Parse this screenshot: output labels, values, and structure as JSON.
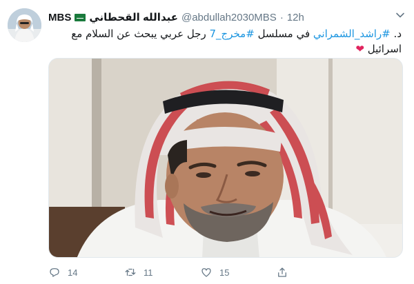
{
  "tweet": {
    "display_name": "عبدالله القحطاني",
    "name_suffix": "MBS",
    "handle": "@abdullah2030MBS",
    "separator": "·",
    "time": "12h",
    "text_prefix": "د.",
    "hashtag_1": "#راشد_الشمراني",
    "text_middle": "في مسلسل",
    "hashtag_2": "#مخرج_7",
    "text_suffix": "رجل عربي يبحث عن السلام مع اسرائيل",
    "heart": "❤",
    "icons": {
      "avatar": "profile-photo",
      "flag": "saudi-flag-icon",
      "caret": "chevron-down-icon",
      "reply": "reply-icon",
      "retweet": "retweet-icon",
      "like": "heart-icon",
      "share": "share-icon"
    },
    "counts": {
      "replies": "14",
      "retweets": "11",
      "likes": "15"
    }
  },
  "colors": {
    "text": "#14171a",
    "secondary": "#657786",
    "link": "#1b95e0",
    "heart": "#e0245e"
  }
}
